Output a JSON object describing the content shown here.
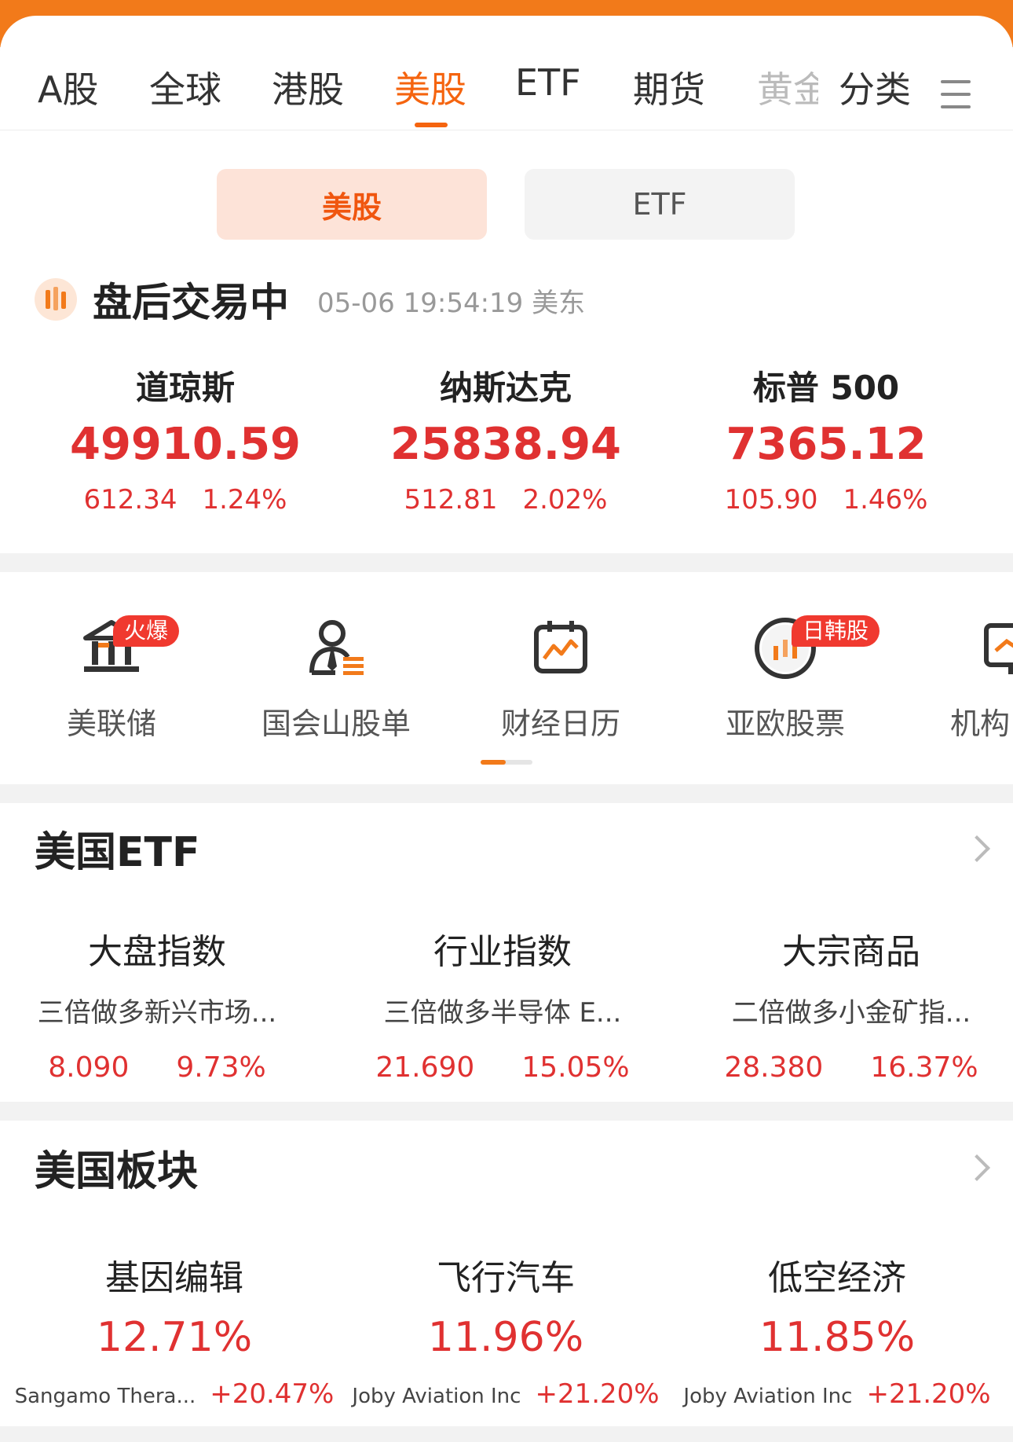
{
  "tabs": [
    {
      "label": "A股"
    },
    {
      "label": "全球"
    },
    {
      "label": "港股"
    },
    {
      "label": "美股",
      "active": true
    },
    {
      "label": "ETF"
    },
    {
      "label": "期货"
    },
    {
      "label": "黄金"
    },
    {
      "label": "分类"
    }
  ],
  "menu_icon": "hamburger-menu-icon",
  "segments": {
    "us_stocks": "美股",
    "etf": "ETF"
  },
  "status": {
    "title": "盘后交易中",
    "time": "05-06 19:54:19 美东",
    "icon": "candlestick-icon"
  },
  "indices": [
    {
      "name": "道琼斯",
      "value": "49910.59",
      "change": "612.34",
      "percent": "1.24%"
    },
    {
      "name": "纳斯达克",
      "value": "25838.94",
      "change": "512.81",
      "percent": "2.02%"
    },
    {
      "name": "标普 500",
      "value": "7365.12",
      "change": "105.90",
      "percent": "1.46%"
    }
  ],
  "tools": [
    {
      "label": "美联储",
      "badge": "火爆",
      "icon": "bank-icon"
    },
    {
      "label": "国会山股单",
      "icon": "person-list-icon"
    },
    {
      "label": "财经日历",
      "icon": "calendar-chart-icon"
    },
    {
      "label": "亚欧股票",
      "badge": "日韩股",
      "icon": "globe-candles-icon"
    },
    {
      "label": "机构",
      "icon": "monitor-chart-icon"
    }
  ],
  "us_etf": {
    "title": "美国ETF",
    "items": [
      {
        "category": "大盘指数",
        "name": "三倍做多新兴市场...",
        "price": "8.090",
        "percent": "9.73%"
      },
      {
        "category": "行业指数",
        "name": "三倍做多半导体 E...",
        "price": "21.690",
        "percent": "15.05%"
      },
      {
        "category": "大宗商品",
        "name": "二倍做多小金矿指...",
        "price": "28.380",
        "percent": "16.37%"
      }
    ]
  },
  "us_sectors": {
    "title": "美国板块",
    "items": [
      {
        "name": "基因编辑",
        "percent": "12.71%",
        "leader": "Sangamo Thera...",
        "leader_percent": "+20.47%"
      },
      {
        "name": "飞行汽车",
        "percent": "11.96%",
        "leader": "Joby Aviation Inc",
        "leader_percent": "+21.20%"
      },
      {
        "name": "低空经济",
        "percent": "11.85%",
        "leader": "Joby Aviation Inc",
        "leader_percent": "+21.20%"
      }
    ]
  },
  "colors": {
    "accent": "#f5640f",
    "up": "#e03131",
    "header": "#f27a1a"
  }
}
